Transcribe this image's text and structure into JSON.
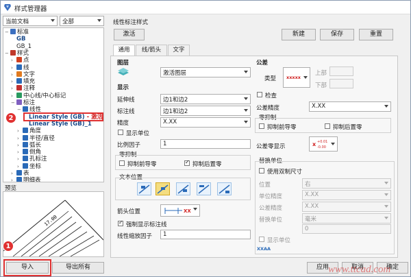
{
  "window": {
    "title": "样式管理器"
  },
  "left": {
    "doc_select": "当前文档",
    "filter_select": "全部",
    "tree": [
      {
        "label": "标准",
        "indent": 0,
        "toggle": "−",
        "icon": "standard-icon"
      },
      {
        "label": "GB",
        "indent": 1,
        "toggle": "",
        "icon": "",
        "bold": true
      },
      {
        "label": "GB_1",
        "indent": 1,
        "toggle": "",
        "icon": ""
      },
      {
        "label": "样式",
        "indent": 0,
        "toggle": "−",
        "icon": "styles-icon"
      },
      {
        "label": "点",
        "indent": 1,
        "toggle": "›",
        "icon": "point-icon"
      },
      {
        "label": "线",
        "indent": 1,
        "toggle": "›",
        "icon": "line-icon"
      },
      {
        "label": "文字",
        "indent": 1,
        "toggle": "›",
        "icon": "text-icon"
      },
      {
        "label": "填充",
        "indent": 1,
        "toggle": "›",
        "icon": "fill-icon"
      },
      {
        "label": "注释",
        "indent": 1,
        "toggle": "›",
        "icon": "annotation-icon"
      },
      {
        "label": "中心线/中心标记",
        "indent": 1,
        "toggle": "›",
        "icon": "centerline-icon"
      },
      {
        "label": "标注",
        "indent": 1,
        "toggle": "−",
        "icon": "dimension-icon"
      },
      {
        "label": "线性",
        "indent": 2,
        "toggle": "−",
        "icon": "linear-icon"
      },
      {
        "label": "Linear Style (GB)",
        "indent": 3,
        "toggle": "",
        "icon": "",
        "bold": true,
        "active": true
      },
      {
        "label": "Linear Style (GB)_1",
        "indent": 3,
        "toggle": "",
        "icon": "",
        "bold": true
      },
      {
        "label": "角度",
        "indent": 2,
        "toggle": "›",
        "icon": "angle-icon"
      },
      {
        "label": "半径/直径",
        "indent": 2,
        "toggle": "›",
        "icon": "radius-icon"
      },
      {
        "label": "弧长",
        "indent": 2,
        "toggle": "›",
        "icon": "arc-icon"
      },
      {
        "label": "倒角",
        "indent": 2,
        "toggle": "›",
        "icon": "chamfer-icon"
      },
      {
        "label": "孔标注",
        "indent": 2,
        "toggle": "›",
        "icon": "hole-icon"
      },
      {
        "label": "坐标",
        "indent": 2,
        "toggle": "›",
        "icon": "coordinate-icon"
      },
      {
        "label": "表",
        "indent": 1,
        "toggle": "›",
        "icon": "table-icon"
      },
      {
        "label": "明细表",
        "indent": 1,
        "toggle": "›",
        "icon": "bom-icon"
      }
    ],
    "active_suffix": " - 激活",
    "preview_label": "预览",
    "preview_dim_text": "17.00",
    "import_btn": "导入",
    "export_btn": "导出所有",
    "badge1": "1",
    "badge2": "2"
  },
  "right": {
    "section_title": "线性标注样式",
    "activate_btn": "激活",
    "new_btn": "新建",
    "save_btn": "保存",
    "reset_btn": "重置",
    "tabs": [
      "通用",
      "线/箭头",
      "文字"
    ],
    "layer": {
      "title": "图层",
      "value": "激活图层"
    },
    "display": {
      "title": "显示",
      "ext_line_label": "延伸线",
      "ext_line_value": "边1和边2",
      "dim_line_label": "标注线",
      "dim_line_value": "边1和边2",
      "precision_label": "精度",
      "precision_value": "X.XX",
      "show_unit_label": "显示单位",
      "scale_label": "比例因子",
      "scale_value": "1"
    },
    "suppress": {
      "title": "零抑制",
      "leading": "抑制前导零",
      "trailing": "抑制后置零"
    },
    "text_pos": {
      "title": "文本位置"
    },
    "arrow_pos_label": "箭头位置",
    "arrow_xx": "XX",
    "force_line_label": "强制显示标注线",
    "linear_scale_label": "线性缩放因子",
    "linear_scale_value": "1",
    "tolerance": {
      "title": "公差",
      "type_label": "类型",
      "type_value": "xxxxx",
      "upper": "上部",
      "lower": "下部",
      "check_label": "检查",
      "precision_label": "公差精度",
      "precision_value": "X.XX",
      "zero_title": "零抑制",
      "leading": "抑制前导零",
      "trailing": "抑制后置零",
      "zero_display_label": "公差零显示",
      "tol_top": "+0.01",
      "tol_bottom": "-0.00"
    },
    "alt": {
      "title": "替换单位",
      "dual_label": "使用双制尺寸",
      "position_label": "位置",
      "position_value": "右",
      "unit_prec_label": "单位精度",
      "unit_prec_value": "X.XX",
      "tol_prec_label": "公差精度",
      "tol_prec_value": "X.XX",
      "alt_unit_label": "替换单位",
      "alt_unit_value": "毫米",
      "zero_value": "0",
      "show_unit_label": "显示单位",
      "sample": "XXAA"
    }
  },
  "footer": {
    "apply": "应用",
    "cancel": "取消",
    "ok": "确定",
    "watermark": "www.ttcad.com"
  }
}
